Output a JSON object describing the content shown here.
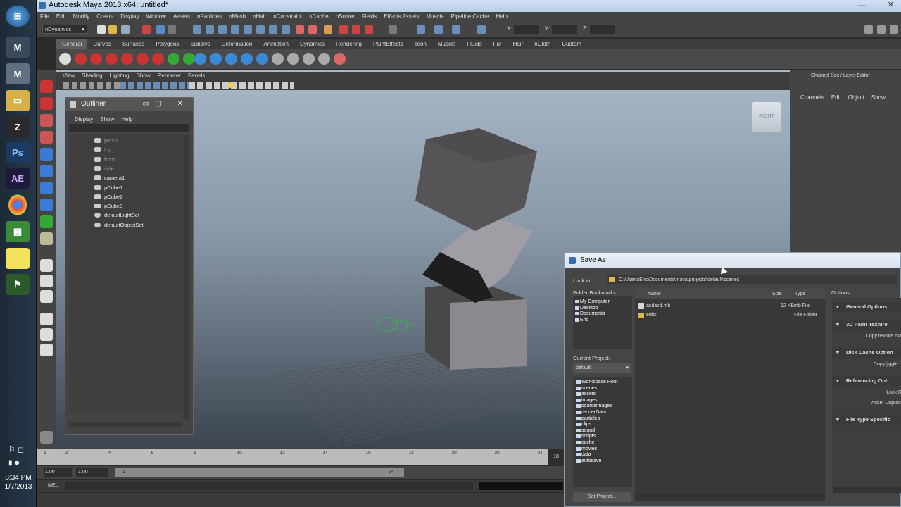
{
  "title": "Autodesk Maya 2013 x64: untitled*",
  "menus": [
    "File",
    "Edit",
    "Modify",
    "Create",
    "Display",
    "Window",
    "Assets",
    "nParticles",
    "nMesh",
    "nHair",
    "nConstraint",
    "nCache",
    "nSolver",
    "Fields",
    "Effects Assets",
    "Muscle",
    "Pipeline Cache",
    "Help"
  ],
  "menuset": "nDynamics",
  "coords": {
    "x": "X:",
    "y": "Y:",
    "z": "Z:"
  },
  "shelf_tabs": [
    "General",
    "Curves",
    "Surfaces",
    "Polygons",
    "Subdivs",
    "Deformation",
    "Animation",
    "Dynamics",
    "Rendering",
    "PaintEffects",
    "Toon",
    "Muscle",
    "Fluids",
    "Fur",
    "Hair",
    "nCloth",
    "Custom"
  ],
  "viewport_menu": [
    "View",
    "Shading",
    "Lighting",
    "Show",
    "Renderer",
    "Panels"
  ],
  "viewcube_label": "RIGHT",
  "channelbox": {
    "header": "Channel Box / Layer Editor",
    "menus": [
      "Channels",
      "Edit",
      "Object",
      "Show"
    ]
  },
  "outliner": {
    "title": "Outliner",
    "menus": [
      "Display",
      "Show",
      "Help"
    ],
    "items": [
      {
        "label": "persp",
        "dim": true
      },
      {
        "label": "top",
        "dim": true
      },
      {
        "label": "front",
        "dim": true
      },
      {
        "label": "side",
        "dim": true
      },
      {
        "label": "camera1",
        "dim": false
      },
      {
        "label": "pCube1",
        "dim": false
      },
      {
        "label": "pCube2",
        "dim": false
      },
      {
        "label": "pCube3",
        "dim": false
      },
      {
        "label": "defaultLightSet",
        "dim": false
      },
      {
        "label": "defaultObjectSet",
        "dim": false
      }
    ]
  },
  "timeline": {
    "ticks": [
      "1",
      "2",
      "4",
      "6",
      "8",
      "10",
      "12",
      "14",
      "16",
      "18",
      "20",
      "22",
      "24"
    ],
    "current_end": "18"
  },
  "range": {
    "start": "1.00",
    "inner_start": "1.00",
    "slider_start": "1",
    "slider_end": "24"
  },
  "cmdline": {
    "label": "MEL"
  },
  "clock": {
    "time": "8:34 PM",
    "date": "1/7/2013"
  },
  "saveas": {
    "title": "Save As",
    "look_in_label": "Look in:",
    "look_in_path": "C:\\Users\\Eric\\Documents\\maya\\projects\\default\\scenes",
    "bookmarks_label": "Folder Bookmarks:",
    "bookmarks": [
      "My Computer",
      "Desktop",
      "Documents",
      "Eric"
    ],
    "current_project_label": "Current Project:",
    "current_project": "default",
    "project_dirs": [
      "Workspace Root",
      "scenes",
      "assets",
      "images",
      "sourceimages",
      "renderData",
      "particles",
      "clips",
      "sound",
      "scripts",
      "cache",
      "movies",
      "data",
      "autosave"
    ],
    "columns": {
      "name": "Name",
      "size": "Size",
      "type": "Type"
    },
    "files": [
      {
        "name": "asdasd.mb",
        "size": "12 KB",
        "type": "mb File"
      },
      {
        "name": "edits",
        "size": "",
        "type": "File Folder"
      }
    ],
    "options_label": "Options...",
    "sections": [
      {
        "label": "General Options",
        "button": ""
      },
      {
        "label": "3D Paint Texture",
        "button": "Copy texture ma"
      },
      {
        "label": "Disk Cache Option",
        "button": "Copy jiggle fi"
      },
      {
        "label": "Referencing Opti",
        "button": "Lock R"
      },
      {
        "label": "File Type Specific",
        "button": ""
      }
    ],
    "asset_unpublish": "Asset Unpubli",
    "set_project_button": "Set Project..."
  }
}
